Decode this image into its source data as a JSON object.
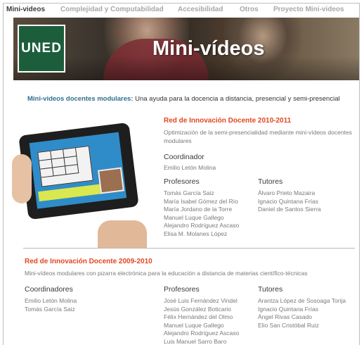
{
  "nav": {
    "items": [
      {
        "label": "Mini-videos"
      },
      {
        "label": "Complejidad y Computabilidad"
      },
      {
        "label": "Accesibilidad"
      },
      {
        "label": "Otros"
      },
      {
        "label": "Proyecto Mini-videos"
      }
    ]
  },
  "banner": {
    "logo_text": "UNED",
    "title": "Mini-vídeos"
  },
  "intro": {
    "highlight": "Mini-videos docentes modulares:",
    "text": " Una ayuda para la docencia a distancia, presencial y semi-presencial"
  },
  "net2010": {
    "title": "Red de Innovación Docente 2010-2011",
    "desc": "Optimización de la semi-presencialidad mediante mini-vídeos docentes modulares",
    "coord_label": "Coordinador",
    "coordinators": [
      "Emilio Letón Molina"
    ],
    "prof_label": "Profesores",
    "professors": [
      "Tomás García Saiz",
      "María Isabel Gómez del Río",
      "María Jordano de la Torre",
      "Manuel Luque Gallego",
      "Alejandro Rodríguez Ascaso",
      "Elisa M. Molanes López"
    ],
    "tutor_label": "Tutores",
    "tutors": [
      "Álvaro Prieto Mazaira",
      "Ignacio Quintana Frías",
      "Daniel de Santos Sierra"
    ]
  },
  "net2009": {
    "title": "Red de Innovación Docente 2009-2010",
    "desc": "Mini-vídeos modulares con pizarra electrónica para la educación a distancia de materias científico-técnicas",
    "coord_label": "Coordinadores",
    "coordinators": [
      "Emilio Letón Molina",
      "Tomás García Saiz"
    ],
    "prof_label": "Profesores",
    "professors": [
      "José Luis Fernández Vindel",
      "Jesús González Boticario",
      "Félix Hernández del Olmo",
      "Manuel Luque Gallego",
      "Alejandro Rodríguez Ascaso",
      "Luis Manuel Sarro Baro"
    ],
    "tutor_label": "Tutores",
    "tutors": [
      "Arantza López de Sosoaga Torija",
      "Ignacio Quintana Frías",
      "Ángel Rivas Casado",
      "Elio San Cristóbal Ruiz"
    ]
  },
  "colors": {
    "accent_red": "#e3461f",
    "accent_blue": "#2f6f8f",
    "logo_green": "#1c5e3c"
  }
}
